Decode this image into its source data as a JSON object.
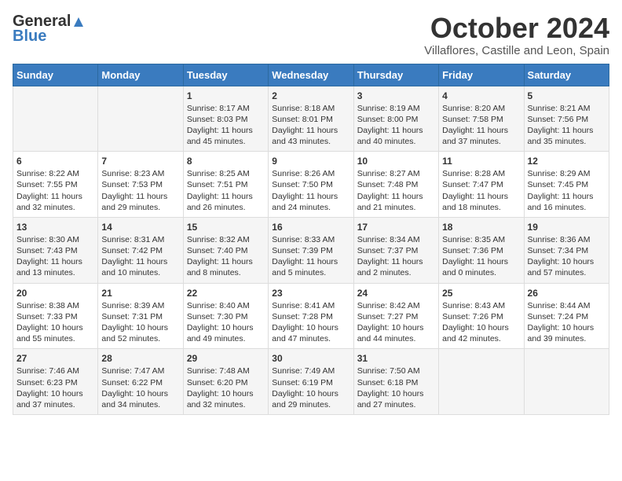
{
  "header": {
    "logo_general": "General",
    "logo_blue": "Blue",
    "month": "October 2024",
    "location": "Villaflores, Castille and Leon, Spain"
  },
  "days_of_week": [
    "Sunday",
    "Monday",
    "Tuesday",
    "Wednesday",
    "Thursday",
    "Friday",
    "Saturday"
  ],
  "weeks": [
    [
      {
        "day": "",
        "content": ""
      },
      {
        "day": "",
        "content": ""
      },
      {
        "day": "1",
        "content": "Sunrise: 8:17 AM\nSunset: 8:03 PM\nDaylight: 11 hours\nand 45 minutes."
      },
      {
        "day": "2",
        "content": "Sunrise: 8:18 AM\nSunset: 8:01 PM\nDaylight: 11 hours\nand 43 minutes."
      },
      {
        "day": "3",
        "content": "Sunrise: 8:19 AM\nSunset: 8:00 PM\nDaylight: 11 hours\nand 40 minutes."
      },
      {
        "day": "4",
        "content": "Sunrise: 8:20 AM\nSunset: 7:58 PM\nDaylight: 11 hours\nand 37 minutes."
      },
      {
        "day": "5",
        "content": "Sunrise: 8:21 AM\nSunset: 7:56 PM\nDaylight: 11 hours\nand 35 minutes."
      }
    ],
    [
      {
        "day": "6",
        "content": "Sunrise: 8:22 AM\nSunset: 7:55 PM\nDaylight: 11 hours\nand 32 minutes."
      },
      {
        "day": "7",
        "content": "Sunrise: 8:23 AM\nSunset: 7:53 PM\nDaylight: 11 hours\nand 29 minutes."
      },
      {
        "day": "8",
        "content": "Sunrise: 8:25 AM\nSunset: 7:51 PM\nDaylight: 11 hours\nand 26 minutes."
      },
      {
        "day": "9",
        "content": "Sunrise: 8:26 AM\nSunset: 7:50 PM\nDaylight: 11 hours\nand 24 minutes."
      },
      {
        "day": "10",
        "content": "Sunrise: 8:27 AM\nSunset: 7:48 PM\nDaylight: 11 hours\nand 21 minutes."
      },
      {
        "day": "11",
        "content": "Sunrise: 8:28 AM\nSunset: 7:47 PM\nDaylight: 11 hours\nand 18 minutes."
      },
      {
        "day": "12",
        "content": "Sunrise: 8:29 AM\nSunset: 7:45 PM\nDaylight: 11 hours\nand 16 minutes."
      }
    ],
    [
      {
        "day": "13",
        "content": "Sunrise: 8:30 AM\nSunset: 7:43 PM\nDaylight: 11 hours\nand 13 minutes."
      },
      {
        "day": "14",
        "content": "Sunrise: 8:31 AM\nSunset: 7:42 PM\nDaylight: 11 hours\nand 10 minutes."
      },
      {
        "day": "15",
        "content": "Sunrise: 8:32 AM\nSunset: 7:40 PM\nDaylight: 11 hours\nand 8 minutes."
      },
      {
        "day": "16",
        "content": "Sunrise: 8:33 AM\nSunset: 7:39 PM\nDaylight: 11 hours\nand 5 minutes."
      },
      {
        "day": "17",
        "content": "Sunrise: 8:34 AM\nSunset: 7:37 PM\nDaylight: 11 hours\nand 2 minutes."
      },
      {
        "day": "18",
        "content": "Sunrise: 8:35 AM\nSunset: 7:36 PM\nDaylight: 11 hours\nand 0 minutes."
      },
      {
        "day": "19",
        "content": "Sunrise: 8:36 AM\nSunset: 7:34 PM\nDaylight: 10 hours\nand 57 minutes."
      }
    ],
    [
      {
        "day": "20",
        "content": "Sunrise: 8:38 AM\nSunset: 7:33 PM\nDaylight: 10 hours\nand 55 minutes."
      },
      {
        "day": "21",
        "content": "Sunrise: 8:39 AM\nSunset: 7:31 PM\nDaylight: 10 hours\nand 52 minutes."
      },
      {
        "day": "22",
        "content": "Sunrise: 8:40 AM\nSunset: 7:30 PM\nDaylight: 10 hours\nand 49 minutes."
      },
      {
        "day": "23",
        "content": "Sunrise: 8:41 AM\nSunset: 7:28 PM\nDaylight: 10 hours\nand 47 minutes."
      },
      {
        "day": "24",
        "content": "Sunrise: 8:42 AM\nSunset: 7:27 PM\nDaylight: 10 hours\nand 44 minutes."
      },
      {
        "day": "25",
        "content": "Sunrise: 8:43 AM\nSunset: 7:26 PM\nDaylight: 10 hours\nand 42 minutes."
      },
      {
        "day": "26",
        "content": "Sunrise: 8:44 AM\nSunset: 7:24 PM\nDaylight: 10 hours\nand 39 minutes."
      }
    ],
    [
      {
        "day": "27",
        "content": "Sunrise: 7:46 AM\nSunset: 6:23 PM\nDaylight: 10 hours\nand 37 minutes."
      },
      {
        "day": "28",
        "content": "Sunrise: 7:47 AM\nSunset: 6:22 PM\nDaylight: 10 hours\nand 34 minutes."
      },
      {
        "day": "29",
        "content": "Sunrise: 7:48 AM\nSunset: 6:20 PM\nDaylight: 10 hours\nand 32 minutes."
      },
      {
        "day": "30",
        "content": "Sunrise: 7:49 AM\nSunset: 6:19 PM\nDaylight: 10 hours\nand 29 minutes."
      },
      {
        "day": "31",
        "content": "Sunrise: 7:50 AM\nSunset: 6:18 PM\nDaylight: 10 hours\nand 27 minutes."
      },
      {
        "day": "",
        "content": ""
      },
      {
        "day": "",
        "content": ""
      }
    ]
  ]
}
